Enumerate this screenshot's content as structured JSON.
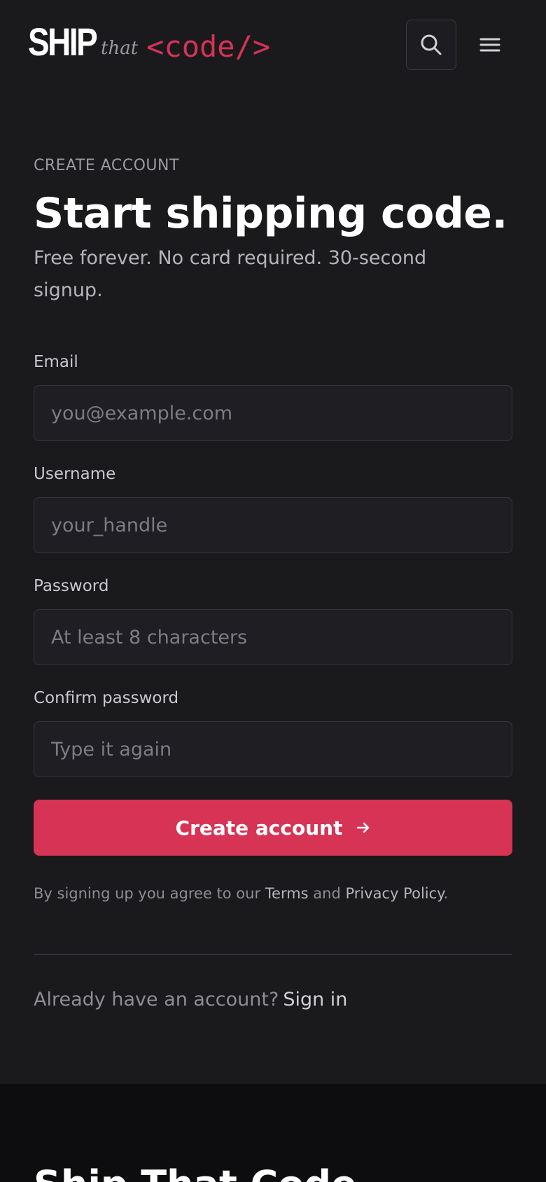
{
  "header": {
    "logo": {
      "ship": "SHIP",
      "that": "that",
      "code": "<code/>"
    },
    "search_icon": "search-icon",
    "menu_icon": "hamburger-menu-icon"
  },
  "signup": {
    "eyebrow": "CREATE ACCOUNT",
    "title": "Start shipping code.",
    "subtitle": "Free forever. No card required. 30-second signup.",
    "fields": {
      "email": {
        "label": "Email",
        "placeholder": "you@example.com",
        "value": ""
      },
      "username": {
        "label": "Username",
        "placeholder": "your_handle",
        "value": ""
      },
      "password": {
        "label": "Password",
        "placeholder": "At least 8 characters",
        "value": ""
      },
      "confirm": {
        "label": "Confirm password",
        "placeholder": "Type it again",
        "value": ""
      }
    },
    "submit_label": "Create account",
    "submit_icon": "arrow-right-icon",
    "legal": {
      "prefix": "By signing up you agree to our ",
      "terms": "Terms",
      "and": " and ",
      "privacy": "Privacy Policy",
      "suffix": "."
    },
    "signin": {
      "prompt": "Already have an account?",
      "link": "Sign in"
    }
  },
  "footer": {
    "title": "Ship That Code"
  },
  "colors": {
    "accent": "#d63355",
    "background": "#1a1a1d",
    "footer_bg": "#0d0d0f"
  }
}
